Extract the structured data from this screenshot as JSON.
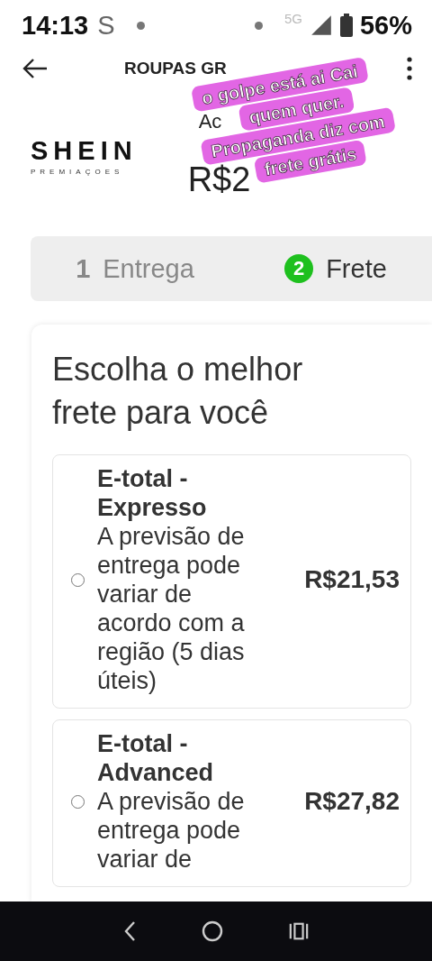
{
  "status_bar": {
    "time": "14:13",
    "carrier_icon": "S",
    "network": "5G",
    "battery": "56%"
  },
  "header": {
    "title": "ROUPAS GR"
  },
  "product": {
    "logo": "SHEIN",
    "logo_sub": "PREMIAÇOES",
    "name": "Ac",
    "price": "R$2"
  },
  "steps": [
    {
      "number": "1",
      "label": "Entrega",
      "selected": false
    },
    {
      "number": "2",
      "label": "Frete",
      "selected": true
    }
  ],
  "heading": "Escolha o melhor frete para você",
  "options": [
    {
      "title": "E-total - Expresso",
      "description": "A previsão de entrega pode variar de acordo com a região (5 dias úteis)",
      "price": "R$21,53",
      "selected": false
    },
    {
      "title": "E-total - Advanced",
      "description": "A previsão de entrega pode variar de",
      "price": "R$27,82",
      "selected": false
    }
  ],
  "overlay_caption": [
    "o golpe está ai Cai",
    "quem quer.",
    "Propaganda diz com",
    "frete grátis"
  ]
}
